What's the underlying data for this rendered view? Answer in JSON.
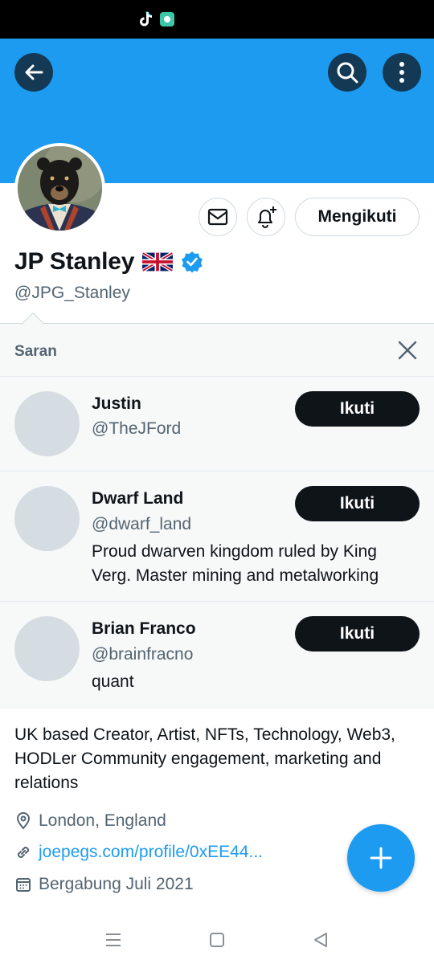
{
  "profile": {
    "display_name": "JP Stanley",
    "flag_emoji": "🇬🇧",
    "verified": true,
    "handle": "@JPG_Stanley",
    "following_label": "Mengikuti",
    "bio": "UK based Creator, Artist, NFTs, Technology, Web3, HODLer Community engagement, marketing and relations",
    "location": "London, England",
    "website": "joepegs.com/profile/0xEE44...",
    "joined": "Bergabung Juli 2021"
  },
  "suggestions": {
    "title": "Saran",
    "follow_label": "Ikuti",
    "items": [
      {
        "name": "Justin",
        "handle": "@TheJFord",
        "bio": ""
      },
      {
        "name": "Dwarf Land",
        "handle": "@dwarf_land",
        "bio": "Proud dwarven kingdom ruled by King Verg. Master mining and metalworking"
      },
      {
        "name": "Brian Franco",
        "handle": "@brainfracno",
        "bio": "quant"
      }
    ]
  },
  "icons": {
    "back": "back-arrow-icon",
    "search": "search-icon",
    "more": "more-vertical-icon",
    "message": "mail-icon",
    "notify": "bell-plus-icon",
    "verified": "verified-badge-icon",
    "close": "close-icon",
    "location": "location-pin-icon",
    "link": "link-icon",
    "calendar": "calendar-icon",
    "compose": "plus-icon"
  },
  "colors": {
    "brand": "#1d9bf0",
    "text": "#0f1419",
    "muted": "#536471",
    "banner": "#1d9bf0"
  }
}
